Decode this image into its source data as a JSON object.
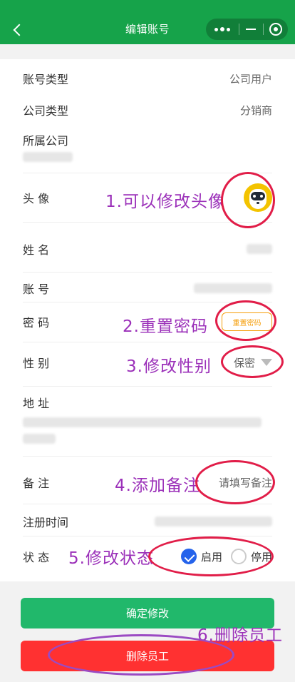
{
  "header": {
    "title": "编辑账号"
  },
  "form": {
    "account_type": {
      "label": "账号类型",
      "value": "公司用户"
    },
    "company_type": {
      "label": "公司类型",
      "value": "分销商"
    },
    "company": {
      "label": "所属公司"
    },
    "avatar": {
      "label": "头 像"
    },
    "name": {
      "label": "姓 名"
    },
    "account": {
      "label": "账 号"
    },
    "password": {
      "label": "密 码",
      "reset_button": "重置密码"
    },
    "gender": {
      "label": "性 别",
      "value": "保密"
    },
    "address": {
      "label": "地 址"
    },
    "remark": {
      "label": "备 注",
      "placeholder": "请填写备注"
    },
    "register_time": {
      "label": "注册时间"
    },
    "status": {
      "label": "状 态",
      "options": [
        "启用",
        "停用"
      ],
      "selected": "启用"
    }
  },
  "buttons": {
    "confirm": "确定修改",
    "delete": "删除员工"
  },
  "annotations": {
    "a1": "1.可以修改头像",
    "a2": "2.重置密码",
    "a3": "3.修改性别",
    "a4": "4.添加备注",
    "a5": "5.修改状态",
    "a6": "6.删除员工"
  },
  "colors": {
    "header": "#16a34a",
    "confirm": "#21b86b",
    "delete": "#ff3131",
    "annotation": "#9b30b9",
    "ring": "#e11d48",
    "reset": "#f59e0b",
    "radio_checked": "#2563eb"
  }
}
